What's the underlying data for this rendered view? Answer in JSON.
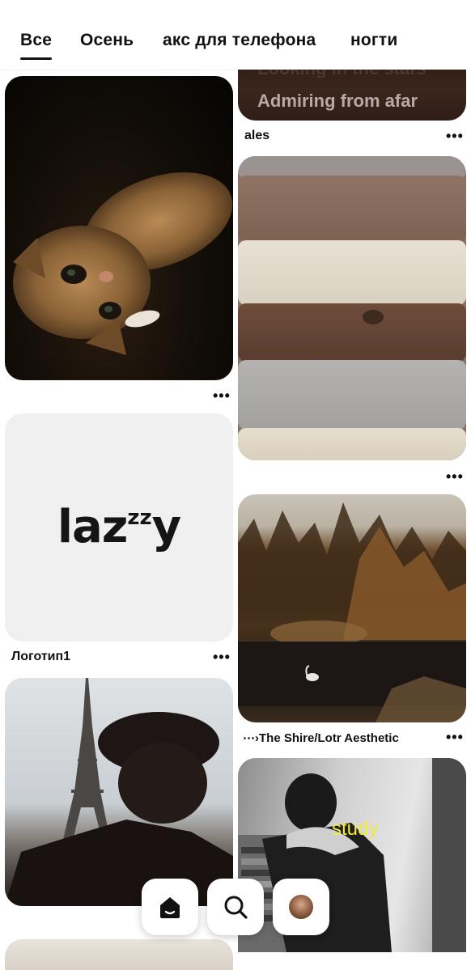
{
  "tabs": [
    {
      "label": "Все",
      "active": true
    },
    {
      "label": "Осень",
      "active": false
    },
    {
      "label": "акс для телефона",
      "active": false
    },
    {
      "label": "ногти",
      "active": false
    }
  ],
  "pins": {
    "quote": {
      "ghost_text": "Looking in the stars",
      "text": "Admiring from afar",
      "caption": "ales",
      "more": "•••"
    },
    "cat": {
      "more": "•••"
    },
    "sweaters": {
      "more": "•••"
    },
    "logo": {
      "logo_text": "laz",
      "logo_sup": "zz",
      "logo_tail": "y",
      "caption": "Логотип1",
      "more": "•••"
    },
    "forest": {
      "caption": "⋯›The Shire/Lotr Aesthetic",
      "more": "•••"
    },
    "study": {
      "overlay_text": "study"
    }
  },
  "bottom_nav": [
    {
      "name": "home",
      "icon": "home-icon",
      "active": true
    },
    {
      "name": "search",
      "icon": "search-icon",
      "active": false
    },
    {
      "name": "profile",
      "icon": "avatar",
      "active": false
    }
  ],
  "colors": {
    "accent": "#111111",
    "study_text": "#f4ea3b"
  }
}
